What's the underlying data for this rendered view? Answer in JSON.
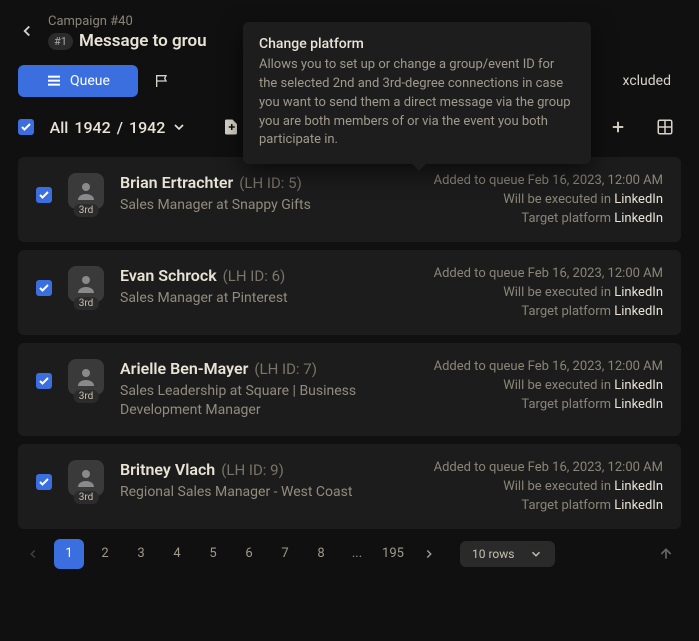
{
  "campaign_label": "Campaign #40",
  "campaign_num": "#1",
  "title": "Message to grou",
  "tabs": {
    "queue": "Queue",
    "excluded_suffix": "xcluded"
  },
  "tooltip": {
    "title": "Change platform",
    "body": "Allows you to set up or change a group/event ID for the selected 2nd and 3rd-degree connections in case you want to send them a direct message via the group you are both members of or via the event you both participate in."
  },
  "filter": {
    "label_prefix": "All",
    "current": "1942",
    "total": "1942"
  },
  "rows": [
    {
      "name": "Brian Ertrachter",
      "lhid": "(LH ID: 5)",
      "role": "Sales Manager at Snappy Gifts",
      "degree": "3rd",
      "added": "Added to queue Feb 16, 2023, 12:00 AM",
      "exec_label": "Will be executed in ",
      "exec_val": "LinkedIn",
      "target_label": "Target platform ",
      "target_val": "LinkedIn"
    },
    {
      "name": "Evan Schrock",
      "lhid": "(LH ID: 6)",
      "role": "Sales Manager at Pinterest",
      "degree": "3rd",
      "added": "Added to queue Feb 16, 2023, 12:00 AM",
      "exec_label": "Will be executed in ",
      "exec_val": "LinkedIn",
      "target_label": "Target platform ",
      "target_val": "LinkedIn"
    },
    {
      "name": "Arielle Ben-Mayer",
      "lhid": "(LH ID: 7)",
      "role": "Sales Leadership at Square | Business Development Manager",
      "degree": "3rd",
      "added": "Added to queue Feb 16, 2023, 12:00 AM",
      "exec_label": "Will be executed in ",
      "exec_val": "LinkedIn",
      "target_label": "Target platform ",
      "target_val": "LinkedIn"
    },
    {
      "name": "Britney Vlach",
      "lhid": "(LH ID: 9)",
      "role": "Regional Sales Manager - West Coast",
      "degree": "3rd",
      "added": "Added to queue Feb 16, 2023, 12:00 AM",
      "exec_label": "Will be executed in ",
      "exec_val": "LinkedIn",
      "target_label": "Target platform ",
      "target_val": "LinkedIn"
    }
  ],
  "pagination": {
    "pages": [
      "1",
      "2",
      "3",
      "4",
      "5",
      "6",
      "7",
      "8",
      "...",
      "195"
    ],
    "rows_label": "rows",
    "rows_value": "10"
  }
}
